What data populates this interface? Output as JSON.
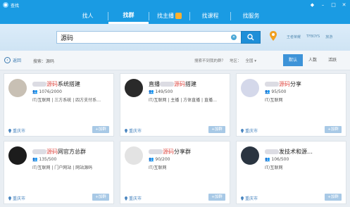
{
  "window": {
    "title": "查找"
  },
  "tabs": [
    {
      "label": "找人"
    },
    {
      "label": "找群",
      "active": true
    },
    {
      "label": "找主播"
    },
    {
      "label": "找课程"
    },
    {
      "label": "找服务"
    }
  ],
  "search": {
    "value": "源码",
    "hint_links": [
      "王者荣耀",
      "TFBOYS",
      "旅游"
    ]
  },
  "filter_bar": {
    "back_label": "返回",
    "crumb": "搜索：源码",
    "not_found_link": "搜索不到我的群？",
    "location": "地区：",
    "scope": "全国",
    "sort_tabs": [
      {
        "label": "默认"
      },
      {
        "label": "人数"
      },
      {
        "label": "活跃"
      }
    ]
  },
  "cards": [
    {
      "title_pre": "",
      "title_red": "源码",
      "title_post": "系统搭建",
      "count": "👥 1076/2000",
      "tags": "IT/互联网  |  三方系统  |  四方支付系…",
      "location": "重庆市",
      "join": "+加群",
      "avatar_color": "#c8c0b4"
    },
    {
      "title_pre": "直播",
      "title_red": "源码",
      "title_post": "搭建",
      "count": "👥 149/500",
      "tags": "IT/互联网  |  主播  |  方体直播  |  直播…",
      "location": "重庆市",
      "join": "+加群",
      "avatar_color": "#2a2a2a"
    },
    {
      "title_pre": "",
      "title_red": "源码",
      "title_post": "分享",
      "count": "👥 95/500",
      "tags": "IT/互联网",
      "location": "重庆市",
      "join": "+加群",
      "avatar_color": "#d4d8ea"
    },
    {
      "title_pre": "",
      "title_red": "源码",
      "title_post": "网官方总群",
      "count": "👥 135/500",
      "tags": "IT/互联网  |  门户网站  |  网站源码",
      "location": "重庆市",
      "join": "+加群",
      "avatar_color": "#1c1c1c"
    },
    {
      "title_pre": "",
      "title_red": "源码",
      "title_post": "分享群",
      "count": "👥 90/200",
      "tags": "IT/互联网",
      "location": "重庆市",
      "join": "+加群",
      "avatar_color": "#e3e3e3"
    },
    {
      "title_pre": "",
      "title_red": "",
      "title_post": "发技术和源…",
      "count": "👥 106/500",
      "tags": "IT/互联网",
      "location": "重庆市",
      "join": "+加群",
      "avatar_color": "#2a3440"
    }
  ]
}
